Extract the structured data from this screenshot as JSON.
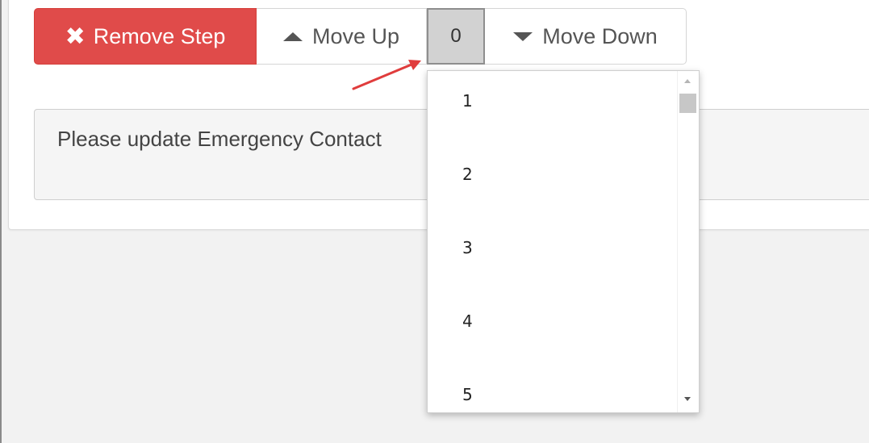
{
  "toolbar": {
    "remove_label": "Remove Step",
    "remove_icon": "times-icon",
    "move_up_label": "Move Up",
    "move_down_label": "Move Down",
    "order_select_value": "0"
  },
  "message": {
    "text": "Please update Emergency Contact"
  },
  "order_dropdown": {
    "options": [
      "1",
      "2",
      "3",
      "4",
      "5"
    ]
  },
  "colors": {
    "remove_button": "#e04b4a",
    "annotation_arrow": "#e03c3c",
    "select_background": "#d2d2d2"
  }
}
